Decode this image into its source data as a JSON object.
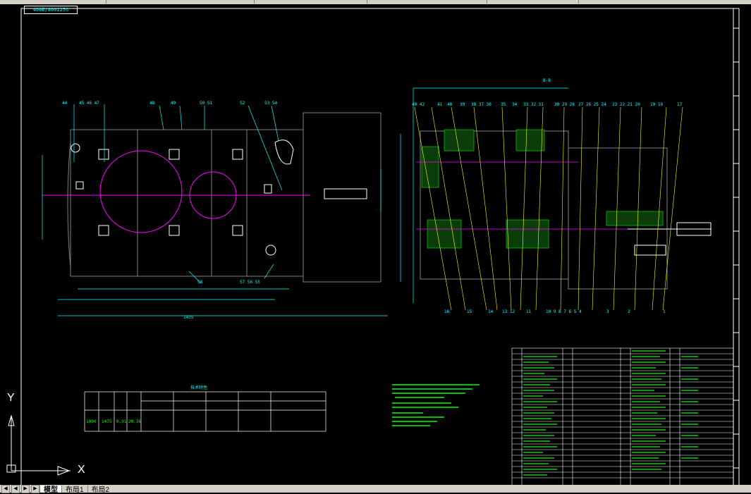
{
  "app": {
    "drawing_code": "400E/800125S"
  },
  "views": {
    "section_label": "B-B"
  },
  "ucs": {
    "x_label": "X",
    "y_label": "Y"
  },
  "tabs": [
    {
      "label": "模型",
      "active": true
    },
    {
      "label": "布局1",
      "active": false
    },
    {
      "label": "布局2",
      "active": false
    }
  ],
  "param_table": {
    "title": "技术特性",
    "row": [
      "1000",
      "1475",
      "0.91",
      "20.36"
    ]
  },
  "colors": {
    "background": "#000000",
    "outline": "#ffffff",
    "dimension": "#00ffff",
    "hidden": "#808080",
    "centerline": "#ff00ff",
    "notes": "#00ff00",
    "leader": "#ffff00"
  },
  "icons": {
    "ucs": "ucs-axis-icon"
  }
}
